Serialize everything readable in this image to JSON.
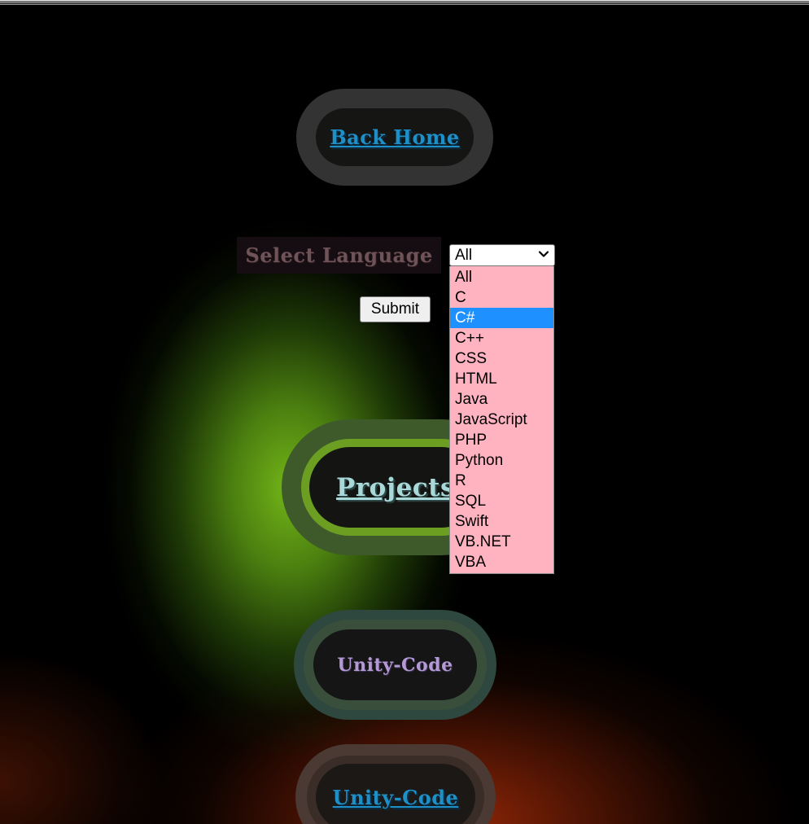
{
  "nav": {
    "back_home": "Back Home"
  },
  "filter": {
    "label": "Select Language",
    "selected_value": "All",
    "highlighted_option": "C#",
    "options": [
      "All",
      "C",
      "C#",
      "C++",
      "CSS",
      "HTML",
      "Java",
      "JavaScript",
      "PHP",
      "Python",
      "R",
      "SQL",
      "Swift",
      "VB.NET",
      "VBA"
    ],
    "submit_label": "Submit"
  },
  "sections": {
    "projects": "Projects",
    "unity_code_heading": "Unity-Code",
    "unity_code_link": "Unity-Code"
  },
  "colors": {
    "link_blue": "#1e8fc7",
    "dropdown_bg": "#ffb3c0",
    "highlight": "#1e90ff",
    "projects_text": "#a8d8d8",
    "unity_purple": "#b49ad4"
  }
}
